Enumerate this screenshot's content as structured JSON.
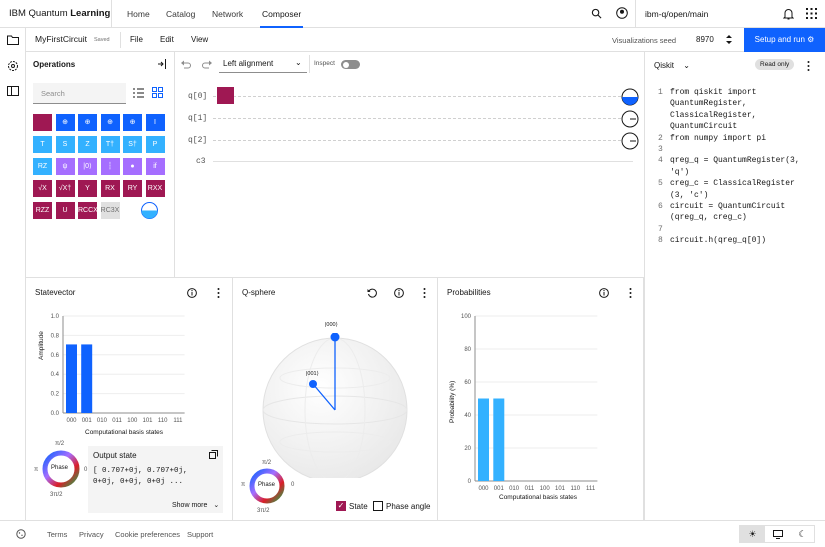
{
  "header": {
    "brand_prefix": "IBM Quantum",
    "brand_bold": "Learning",
    "nav": [
      "Home",
      "Catalog",
      "Network",
      "Composer"
    ],
    "instance": "ibm-q/open/main"
  },
  "toolbar": {
    "circuit_name": "MyFirstCircuit",
    "saved": "Saved",
    "menus": [
      "File",
      "Edit",
      "View"
    ],
    "viz_seed_label": "Visualizations seed",
    "viz_seed_value": "8970",
    "setup_run": "Setup and run"
  },
  "operations": {
    "title": "Operations",
    "search_placeholder": "Search",
    "rows": [
      [
        {
          "label": "",
          "c": "red"
        },
        {
          "label": "⊕",
          "c": "blue"
        },
        {
          "label": "⊕",
          "c": "blue"
        },
        {
          "label": "⊕",
          "c": "blue"
        },
        {
          "label": "⊕",
          "c": "blue"
        },
        {
          "label": "I",
          "c": "blue"
        }
      ],
      [
        {
          "label": "T",
          "c": "lblue"
        },
        {
          "label": "S",
          "c": "lblue"
        },
        {
          "label": "Z",
          "c": "lblue"
        },
        {
          "label": "T†",
          "c": "lblue"
        },
        {
          "label": "S†",
          "c": "lblue"
        },
        {
          "label": "P",
          "c": "lblue"
        }
      ],
      [
        {
          "label": "RZ",
          "c": "lblue"
        },
        {
          "label": "ψ",
          "c": "pink"
        },
        {
          "label": "|0⟩",
          "c": "pink"
        },
        {
          "label": "┆",
          "c": "pink"
        },
        {
          "label": "●",
          "c": "pink"
        },
        {
          "label": "if",
          "c": "pink"
        }
      ],
      [
        {
          "label": "√X",
          "c": "maroon"
        },
        {
          "label": "√X†",
          "c": "maroon"
        },
        {
          "label": "Y",
          "c": "maroon"
        },
        {
          "label": "RX",
          "c": "maroon"
        },
        {
          "label": "RY",
          "c": "maroon"
        },
        {
          "label": "RXX",
          "c": "maroon"
        }
      ],
      [
        {
          "label": "RZZ",
          "c": "maroon"
        },
        {
          "label": "U",
          "c": "maroon"
        },
        {
          "label": "RCCX",
          "c": "maroon"
        },
        {
          "label": "RC3X",
          "c": "grey"
        }
      ]
    ]
  },
  "canvas": {
    "alignment": "Left alignment",
    "inspect": "Inspect",
    "wires": [
      "q[0]",
      "q[1]",
      "q[2]",
      "c3"
    ]
  },
  "code": {
    "language": "Qiskit",
    "mode": "Read only",
    "lines": [
      {
        "n": "1",
        "t": "from qiskit import"
      },
      {
        "n": "",
        "t": "QuantumRegister,"
      },
      {
        "n": "",
        "t": "ClassicalRegister,"
      },
      {
        "n": "",
        "t": "QuantumCircuit"
      },
      {
        "n": "2",
        "t": "from numpy import pi"
      },
      {
        "n": "3",
        "t": ""
      },
      {
        "n": "4",
        "t": "qreg_q = QuantumRegister(3,"
      },
      {
        "n": "",
        "t": "'q')"
      },
      {
        "n": "5",
        "t": "creg_c = ClassicalRegister"
      },
      {
        "n": "",
        "t": "(3, 'c')"
      },
      {
        "n": "6",
        "t": "circuit = QuantumCircuit"
      },
      {
        "n": "",
        "t": "(qreg_q, creg_c)"
      },
      {
        "n": "7",
        "t": ""
      },
      {
        "n": "8",
        "t": "circuit.h(qreg_q[0])"
      }
    ]
  },
  "statevector": {
    "title": "Statevector",
    "ylabel": "Amplitude",
    "xlabel": "Computational basis states",
    "yticks": [
      "1.0",
      "0.8",
      "0.6",
      "0.4",
      "0.2",
      "0.0"
    ],
    "output_title": "Output state",
    "output_text_1": "[ 0.707+0j, 0.707+0j,",
    "output_text_2": "0+0j, 0+0j, 0+0j ...",
    "show_more": "Show more",
    "phase_label": "Phase",
    "phase_top": "π/2",
    "phase_bottom": "3π/2",
    "phase_left": "π",
    "phase_right": "0"
  },
  "qsphere": {
    "title": "Q-sphere",
    "state_label_top": "|000⟩",
    "state_label_mid": "|001⟩",
    "state_cb": "State",
    "phase_cb": "Phase angle",
    "phase_label": "Phase",
    "phase_top": "π/2",
    "phase_bottom": "3π/2",
    "phase_left": "π",
    "phase_right": "0"
  },
  "probabilities": {
    "title": "Probabilities",
    "ylabel": "Probability (%)",
    "xlabel": "Computational basis states",
    "yticks": [
      "100",
      "80",
      "60",
      "40",
      "20",
      "0"
    ]
  },
  "chart_data": [
    {
      "type": "bar",
      "categories": [
        "000",
        "001",
        "010",
        "011",
        "100",
        "101",
        "110",
        "111"
      ],
      "values": [
        0.707,
        0.707,
        0,
        0,
        0,
        0,
        0,
        0
      ],
      "xlabel": "Computational basis states",
      "ylabel": "Amplitude",
      "ylim": [
        0,
        1.0
      ],
      "color": "#0f62fe"
    },
    {
      "type": "bar",
      "categories": [
        "000",
        "001",
        "010",
        "011",
        "100",
        "101",
        "110",
        "111"
      ],
      "values": [
        50,
        50,
        0,
        0,
        0,
        0,
        0,
        0
      ],
      "xlabel": "Computational basis states",
      "ylabel": "Probability (%)",
      "ylim": [
        0,
        100
      ],
      "color": "#33b1ff"
    }
  ],
  "footer": {
    "links": [
      "Terms",
      "Privacy",
      "Cookie preferences",
      "Support"
    ]
  },
  "colors": {
    "accent": "#0f62fe",
    "gate_red": "#9f1853",
    "gate_lblue": "#33b1ff",
    "gate_pink": "#a56eff"
  }
}
